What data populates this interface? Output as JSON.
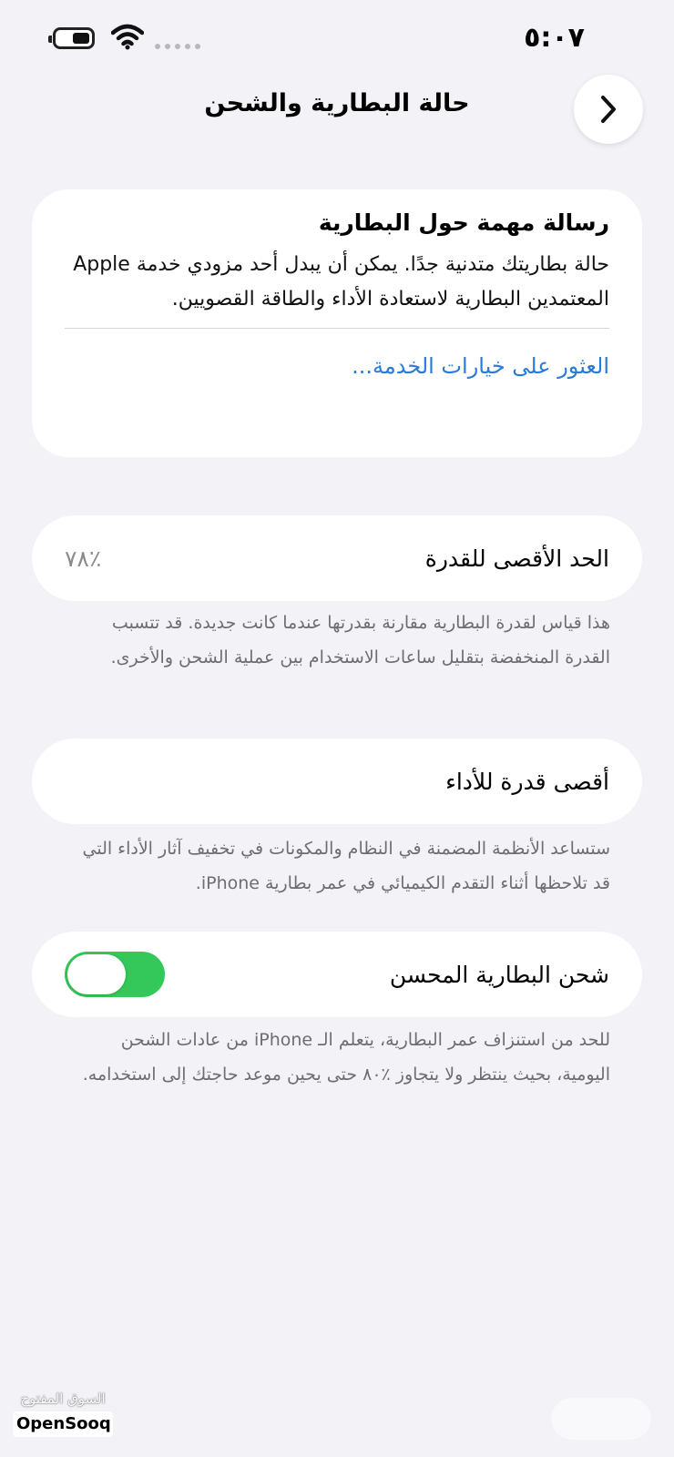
{
  "status_bar": {
    "time": "٥:٠٧"
  },
  "nav": {
    "title": "حالة البطارية والشحن"
  },
  "message_card": {
    "title": "رسالة مهمة حول البطارية",
    "body": "حالة بطاريتك متدنية جدًا. يمكن أن يبدل أحد مزودي خدمة Apple المعتمدين البطارية لاستعادة الأداء والطاقة القصويين.",
    "link": "العثور على خيارات الخدمة..."
  },
  "maximum_capacity": {
    "label": "الحد الأقصى للقدرة",
    "value": "٪٧٨",
    "footnote": "هذا قياس لقدرة البطارية مقارنة بقدرتها عندما كانت جديدة. قد تتسبب القدرة المنخفضة بتقليل ساعات الاستخدام بين عملية الشحن والأخرى."
  },
  "peak_performance": {
    "label": "أقصى قدرة للأداء",
    "footnote": "ستساعد الأنظمة المضمنة في النظام والمكونات في تخفيف آثار الأداء التي قد تلاحظها أثناء التقدم الكيميائي في عمر بطارية iPhone."
  },
  "optimized_charging": {
    "label": "شحن البطارية المحسن",
    "enabled": true,
    "toggle_color": "#34c759",
    "footnote": "للحد من استنزاف عمر البطارية، يتعلم الـ iPhone من عادات الشحن اليومية، بحيث ينتظر ولا يتجاوز ٪٨٠ حتى يحين موعد حاجتك إلى استخدامه."
  },
  "watermark": {
    "arabic": "السوق المفتوح",
    "english": "OpenSooq"
  },
  "colors": {
    "background": "#f2f2f7",
    "link": "#2a7bd6",
    "secondary_text": "#6d6d72"
  }
}
